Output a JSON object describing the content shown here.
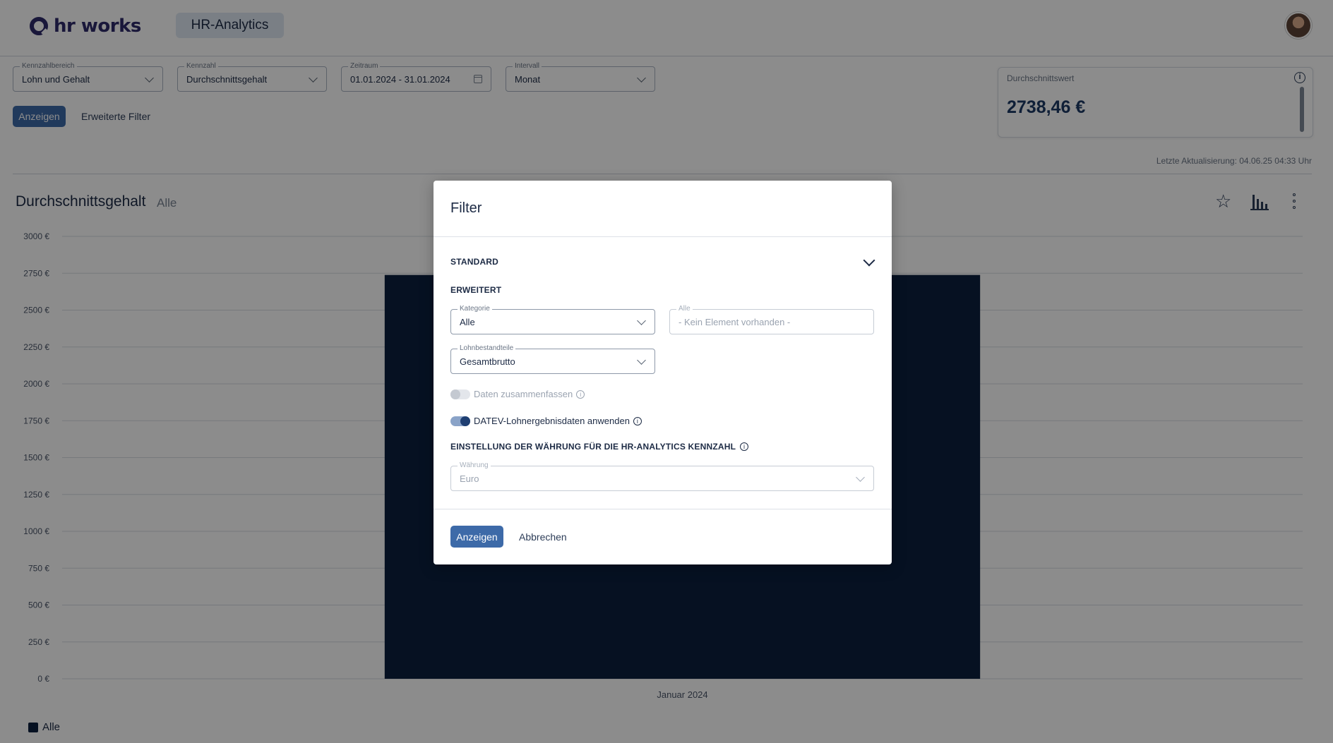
{
  "header": {
    "logo_text": "hr works",
    "app_tab": "HR-Analytics"
  },
  "filters": {
    "kennzahlbereich": {
      "label": "Kennzahlbereich",
      "value": "Lohn und Gehalt"
    },
    "kennzahl": {
      "label": "Kennzahl",
      "value": "Durchschnittsgehalt"
    },
    "zeitraum": {
      "label": "Zeitraum",
      "value": "01.01.2024 - 31.01.2024"
    },
    "intervall": {
      "label": "Intervall",
      "value": "Monat"
    },
    "show_button": "Anzeigen",
    "extended_filter_link": "Erweiterte Filter"
  },
  "kpi": {
    "label": "Durchschnittswert",
    "value": "2738,46 €",
    "info_icon": "i"
  },
  "last_update": "Letzte Aktualisierung: 04.06.25 04:33 Uhr",
  "chart_section": {
    "title": "Durchschnittsgehalt",
    "subtitle": "Alle",
    "star_icon": "☆",
    "legend_label": "Alle"
  },
  "chart_data": {
    "type": "bar",
    "categories": [
      "Januar 2024"
    ],
    "series": [
      {
        "name": "Alle",
        "values": [
          2738.46
        ],
        "color": "#0b1f3f"
      }
    ],
    "yticks": [
      "0 €",
      "250 €",
      "500 €",
      "750 €",
      "1000 €",
      "1250 €",
      "1500 €",
      "1750 €",
      "2000 €",
      "2250 €",
      "2500 €",
      "2750 €",
      "3000 €"
    ],
    "ylim": [
      0,
      3000
    ],
    "grid": true,
    "legend": "bottom-left"
  },
  "modal": {
    "title": "Filter",
    "standard_heading": "STANDARD",
    "extended_heading": "ERWEITERT",
    "kategorie": {
      "label": "Kategorie",
      "value": "Alle"
    },
    "alle_field": {
      "label": "Alle",
      "placeholder": "- Kein Element vorhanden -"
    },
    "lohnbestandteile": {
      "label": "Lohnbestandteile",
      "value": "Gesamtbrutto"
    },
    "toggle_zusammenfassen": {
      "label": "Daten zusammenfassen",
      "on": false
    },
    "toggle_datev": {
      "label": "DATEV-Lohnergebnisdaten anwenden",
      "on": true
    },
    "currency_heading": "EINSTELLUNG DER WÄHRUNG FÜR DIE HR-ANALYTICS KENNZAHL",
    "waehrung": {
      "label": "Währung",
      "value": "Euro"
    },
    "info_icon": "i",
    "submit_button": "Anzeigen",
    "cancel_button": "Abbrechen"
  },
  "colors": {
    "primary": "#3d6aa8",
    "bar": "#0b1f3f",
    "text": "#1d2b45"
  }
}
